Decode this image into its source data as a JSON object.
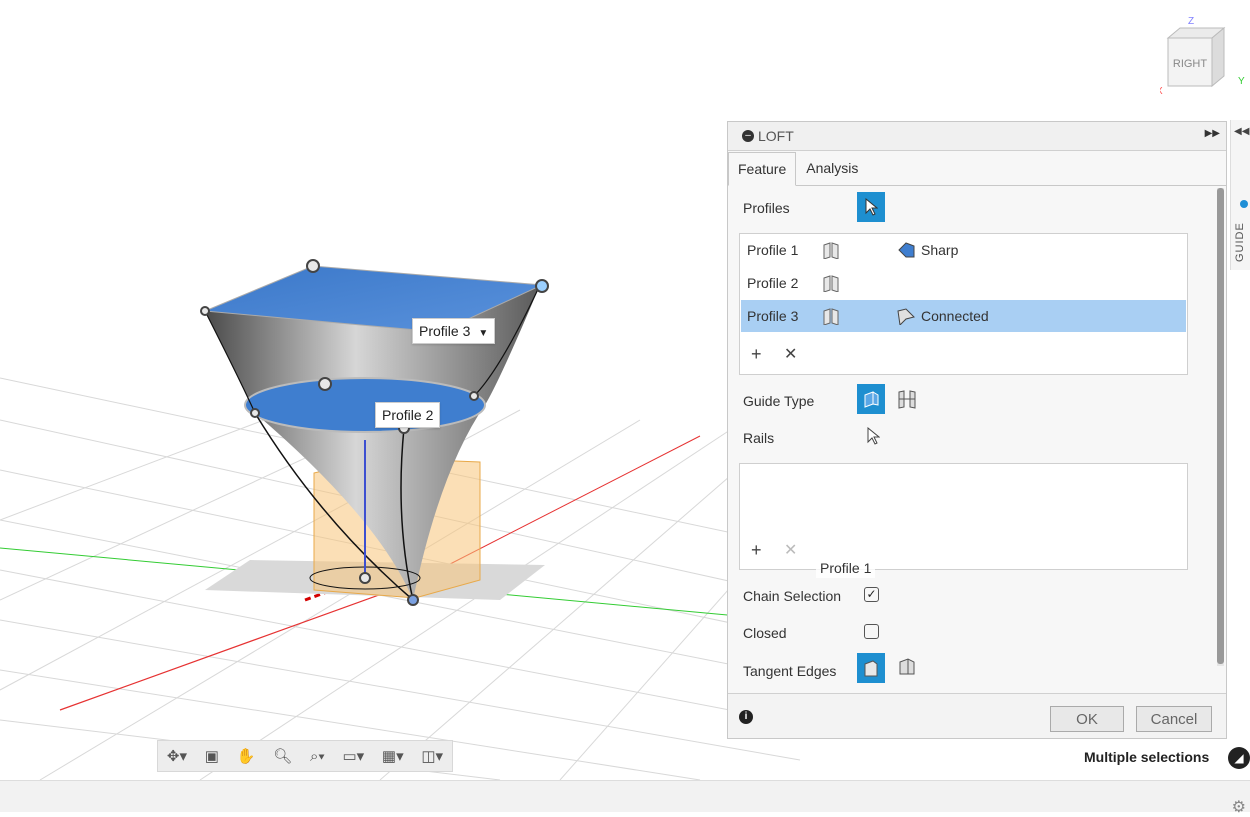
{
  "viewcube": {
    "face": "RIGHT",
    "axis_z": "Z",
    "axis_x": "X",
    "axis_y": "Y"
  },
  "viewport_tags": {
    "profile3": "Profile 3",
    "profile2": "Profile 2",
    "profile1": "Profile 1"
  },
  "dialog": {
    "title": "LOFT",
    "tabs": [
      {
        "label": "Feature"
      },
      {
        "label": "Analysis"
      }
    ],
    "profiles_label": "Profiles",
    "profile_rows": [
      {
        "name": "Profile 1",
        "condition": "Sharp"
      },
      {
        "name": "Profile 2",
        "condition": ""
      },
      {
        "name": "Profile 3",
        "condition": "Connected"
      }
    ],
    "guide_type_label": "Guide Type",
    "rails_label": "Rails",
    "chain_selection_label": "Chain Selection",
    "chain_selection_checked": true,
    "closed_label": "Closed",
    "closed_checked": false,
    "tangent_edges_label": "Tangent Edges",
    "ok_label": "OK",
    "cancel_label": "Cancel"
  },
  "side_panel": {
    "label": "GUIDE"
  },
  "status": {
    "multiple_selections": "Multiple selections"
  }
}
